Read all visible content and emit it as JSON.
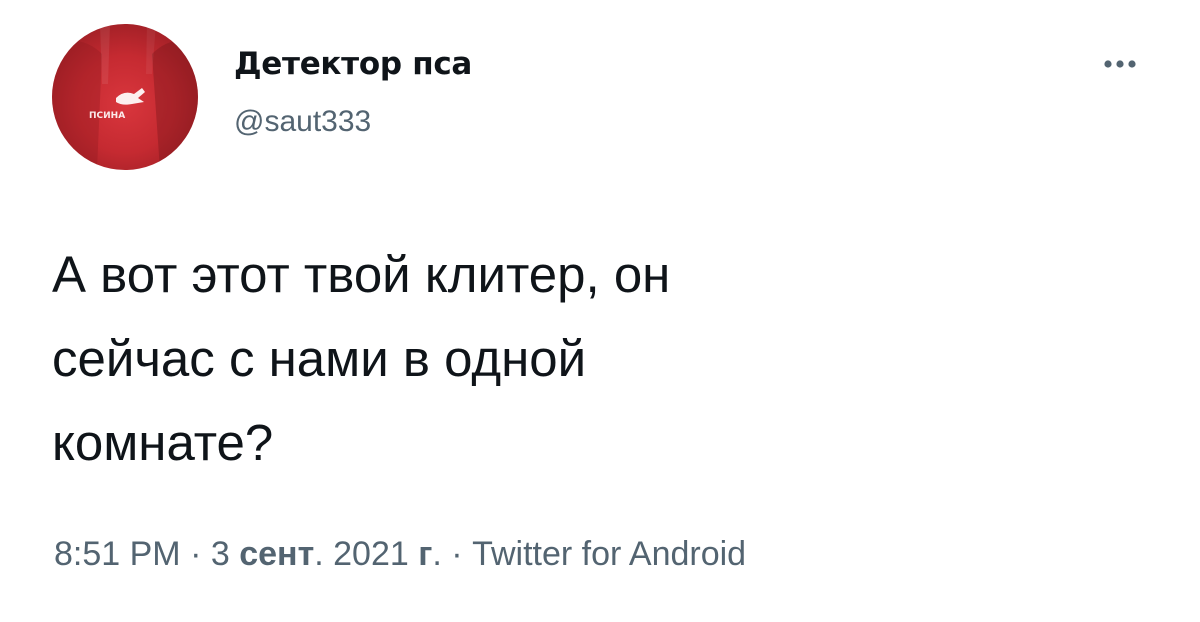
{
  "author": {
    "display_name": "Детектор пса",
    "handle": "@saut333"
  },
  "avatar": {
    "brand_text": "ПСИНА",
    "background_color": "#c52a31"
  },
  "more_icon": "more-horizontal-icon",
  "tweet": {
    "text": "А вот этот твой клитер, он\nсейчас с нами в одной\nкомнате?"
  },
  "meta": {
    "time": "8:51 PM",
    "separator": " · ",
    "date_day": "3",
    "date_month": "сент",
    "date_dot": ". ",
    "date_year": "2021",
    "year_suffix": "г",
    "year_dot": ".",
    "source": "Twitter for Android"
  },
  "colors": {
    "text_primary": "#0f1419",
    "text_secondary": "#536471"
  }
}
